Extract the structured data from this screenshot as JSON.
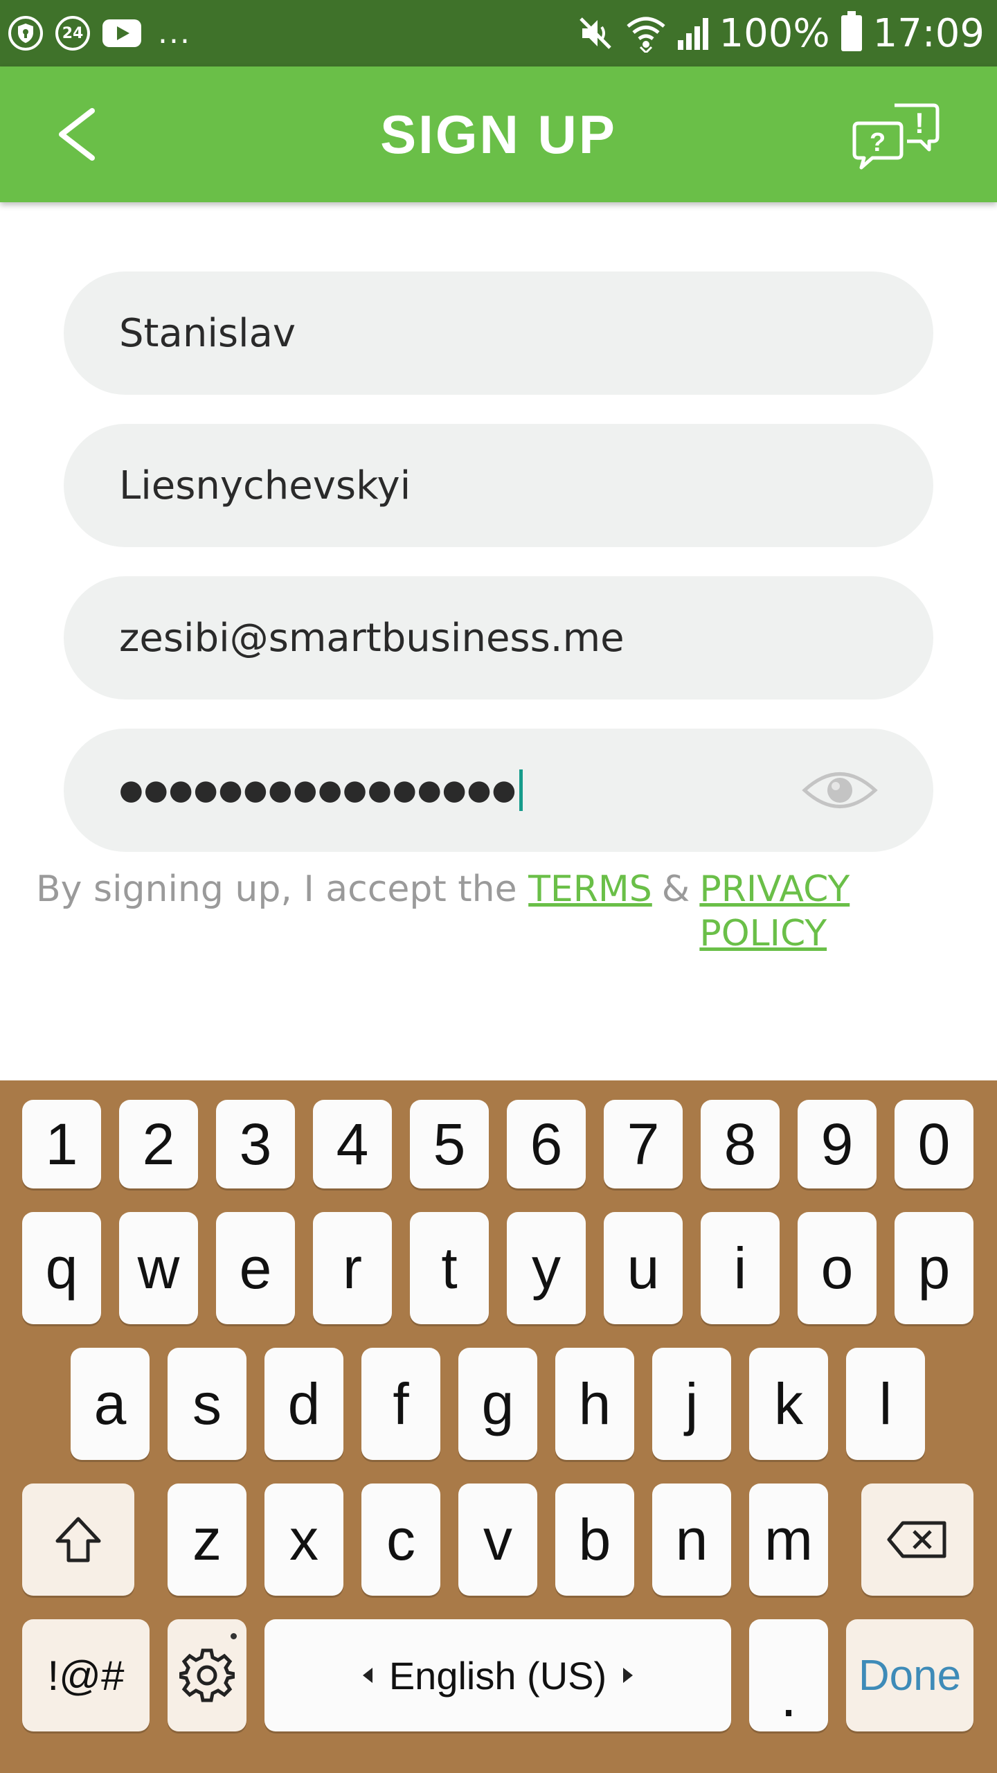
{
  "status_bar": {
    "notification_badge": "24",
    "overflow": "...",
    "battery": "100%",
    "time": "17:09",
    "icons": [
      "shield-icon",
      "badge-24-icon",
      "youtube-icon",
      "mute-icon",
      "wifi-icon",
      "signal-icon",
      "battery-icon"
    ]
  },
  "app_bar": {
    "title": "SIGN UP",
    "back_icon": "chevron-left-icon",
    "help_icon": "chat-help-icon"
  },
  "form": {
    "first_name": "Stanislav",
    "last_name": "Liesnychevskyi",
    "email": "zesibi@smartbusiness.me",
    "password_mask": "●●●●●●●●●●●●●●●●"
  },
  "terms": {
    "prefix": "By signing up, I accept the",
    "terms_link": "TERMS",
    "amp": "&",
    "privacy_line1": "PRIVACY",
    "privacy_line2": "POLICY"
  },
  "keyboard": {
    "row_numbers": [
      "1",
      "2",
      "3",
      "4",
      "5",
      "6",
      "7",
      "8",
      "9",
      "0"
    ],
    "row_top": [
      "q",
      "w",
      "e",
      "r",
      "t",
      "y",
      "u",
      "i",
      "o",
      "p"
    ],
    "row_middle": [
      "a",
      "s",
      "d",
      "f",
      "g",
      "h",
      "j",
      "k",
      "l"
    ],
    "row_bottom": [
      "z",
      "x",
      "c",
      "v",
      "b",
      "n",
      "m"
    ],
    "symbols": "!@#",
    "language": "English (US)",
    "period": ".",
    "done": "Done",
    "colors": {
      "background": "#a97a48",
      "done_text": "#3e8bb8"
    }
  },
  "colors": {
    "status_bar": "#3f722a",
    "app_bar": "#6abf48",
    "field_bg": "#eff1f0",
    "link": "#6abf48",
    "caret": "#179c8c"
  }
}
